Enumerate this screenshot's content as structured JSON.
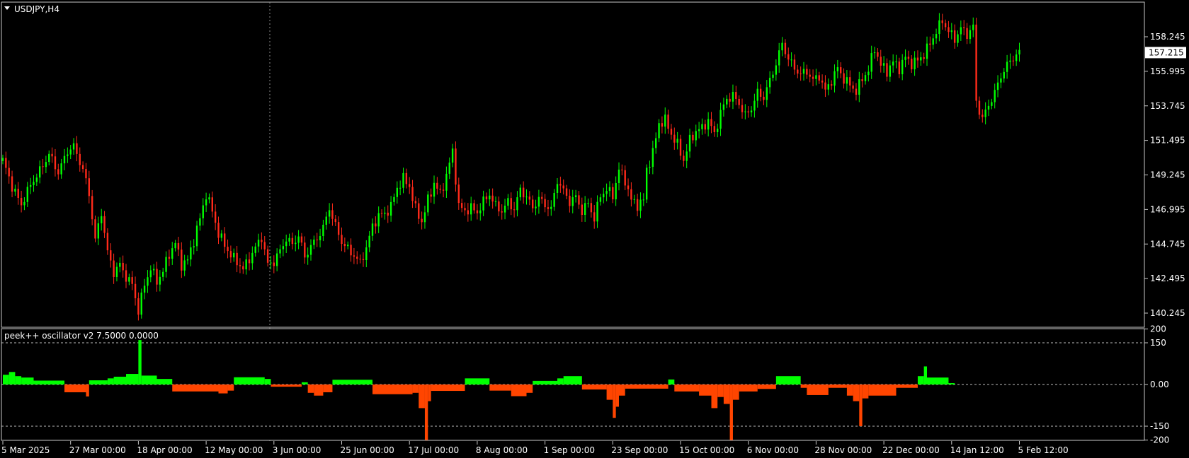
{
  "chart_data": [
    {
      "type": "candlestick",
      "title": "USDJPY,H4",
      "symbol": "USDJPY",
      "timeframe": "H4",
      "current_price_label": "157.215",
      "current_price": 157.215,
      "ylim": [
        139.2,
        160.5
      ],
      "y_ticks": [
        "158.245",
        "155.995",
        "153.745",
        "151.495",
        "149.245",
        "146.995",
        "144.745",
        "142.495",
        "140.245"
      ],
      "y_tick_values": [
        158.245,
        155.995,
        153.745,
        151.495,
        149.245,
        146.995,
        144.745,
        142.495,
        140.245
      ],
      "x_tick_labels": [
        "5 Mar 2025",
        "27 Mar 00:00",
        "18 Apr 00:00",
        "12 May 00:00",
        "3 Jun 00:00",
        "25 Jun 00:00",
        "17 Jul 00:00",
        "8 Aug 00:00",
        "1 Sep 00:00",
        "23 Sep 00:00",
        "15 Oct 00:00",
        "6 Nov 00:00",
        "28 Nov 00:00",
        "22 Dec 00:00",
        "14 Jan 12:00",
        "5 Feb 12:00"
      ],
      "x_ticks_index": [
        0,
        22,
        44,
        66,
        88,
        110,
        132,
        154,
        176,
        198,
        220,
        242,
        264,
        286,
        308,
        330
      ],
      "close_path": [
        [
          0,
          150.2
        ],
        [
          3,
          148.5
        ],
        [
          6,
          147.3
        ],
        [
          9,
          148.6
        ],
        [
          12,
          149.5
        ],
        [
          15,
          150.6
        ],
        [
          18,
          149.4
        ],
        [
          21,
          150.8
        ],
        [
          23,
          151.1
        ],
        [
          26,
          149.6
        ],
        [
          28,
          148.0
        ],
        [
          30,
          145.0
        ],
        [
          32,
          146.8
        ],
        [
          34,
          144.2
        ],
        [
          36,
          142.9
        ],
        [
          38,
          143.4
        ],
        [
          40,
          142.6
        ],
        [
          42,
          142.1
        ],
        [
          44,
          140.4
        ],
        [
          46,
          142.1
        ],
        [
          48,
          143.2
        ],
        [
          50,
          142.3
        ],
        [
          52,
          143.0
        ],
        [
          54,
          144.1
        ],
        [
          56,
          144.8
        ],
        [
          58,
          143.4
        ],
        [
          60,
          143.7
        ],
        [
          62,
          145.0
        ],
        [
          64,
          146.4
        ],
        [
          66,
          148.0
        ],
        [
          68,
          146.9
        ],
        [
          70,
          145.4
        ],
        [
          72,
          144.7
        ],
        [
          74,
          144.0
        ],
        [
          76,
          143.6
        ],
        [
          78,
          143.1
        ],
        [
          80,
          143.8
        ],
        [
          82,
          144.5
        ],
        [
          84,
          145.2
        ],
        [
          86,
          143.4
        ],
        [
          88,
          143.6
        ],
        [
          90,
          144.3
        ],
        [
          92,
          145.1
        ],
        [
          94,
          144.7
        ],
        [
          96,
          145.3
        ],
        [
          98,
          143.9
        ],
        [
          100,
          144.6
        ],
        [
          102,
          145.1
        ],
        [
          104,
          145.8
        ],
        [
          106,
          147.1
        ],
        [
          108,
          145.9
        ],
        [
          110,
          144.9
        ],
        [
          112,
          144.4
        ],
        [
          114,
          144.0
        ],
        [
          116,
          143.5
        ],
        [
          118,
          144.5
        ],
        [
          120,
          145.9
        ],
        [
          122,
          146.6
        ],
        [
          124,
          146.7
        ],
        [
          126,
          147.2
        ],
        [
          128,
          148.4
        ],
        [
          130,
          149.0
        ],
        [
          132,
          148.5
        ],
        [
          134,
          147.0
        ],
        [
          136,
          146.2
        ],
        [
          138,
          147.6
        ],
        [
          140,
          148.7
        ],
        [
          142,
          148.0
        ],
        [
          144,
          149.2
        ],
        [
          146,
          150.8
        ],
        [
          148,
          147.2
        ],
        [
          150,
          146.9
        ],
        [
          152,
          147.1
        ],
        [
          154,
          146.8
        ],
        [
          156,
          147.5
        ],
        [
          158,
          148.0
        ],
        [
          160,
          147.2
        ],
        [
          162,
          146.9
        ],
        [
          164,
          147.5
        ],
        [
          166,
          147.0
        ],
        [
          168,
          148.3
        ],
        [
          170,
          147.8
        ],
        [
          172,
          147.1
        ],
        [
          174,
          147.7
        ],
        [
          176,
          147.3
        ],
        [
          178,
          147.0
        ],
        [
          180,
          148.9
        ],
        [
          182,
          148.2
        ],
        [
          184,
          147.5
        ],
        [
          186,
          147.8
        ],
        [
          188,
          146.9
        ],
        [
          190,
          147.4
        ],
        [
          192,
          146.4
        ],
        [
          194,
          147.9
        ],
        [
          196,
          148.3
        ],
        [
          198,
          147.9
        ],
        [
          200,
          149.6
        ],
        [
          202,
          148.9
        ],
        [
          204,
          147.6
        ],
        [
          206,
          147.3
        ],
        [
          208,
          147.6
        ],
        [
          209,
          149.6
        ],
        [
          211,
          150.7
        ],
        [
          213,
          152.6
        ],
        [
          215,
          152.8
        ],
        [
          217,
          151.9
        ],
        [
          219,
          151.2
        ],
        [
          221,
          150.2
        ],
        [
          223,
          151.5
        ],
        [
          225,
          152.1
        ],
        [
          227,
          152.3
        ],
        [
          229,
          152.8
        ],
        [
          231,
          151.9
        ],
        [
          233,
          153.3
        ],
        [
          235,
          154.2
        ],
        [
          237,
          154.4
        ],
        [
          239,
          153.9
        ],
        [
          241,
          153.1
        ],
        [
          243,
          153.6
        ],
        [
          245,
          154.6
        ],
        [
          247,
          154.3
        ],
        [
          249,
          155.4
        ],
        [
          251,
          156.5
        ],
        [
          253,
          157.8
        ],
        [
          255,
          156.8
        ],
        [
          257,
          156.2
        ],
        [
          259,
          155.8
        ],
        [
          261,
          156.0
        ],
        [
          263,
          155.4
        ],
        [
          265,
          155.7
        ],
        [
          267,
          154.7
        ],
        [
          269,
          155.4
        ],
        [
          271,
          156.2
        ],
        [
          273,
          155.5
        ],
        [
          275,
          155.1
        ],
        [
          277,
          154.7
        ],
        [
          279,
          155.5
        ],
        [
          281,
          156.1
        ],
        [
          283,
          157.5
        ],
        [
          285,
          156.4
        ],
        [
          287,
          156.0
        ],
        [
          289,
          156.6
        ],
        [
          291,
          156.2
        ],
        [
          293,
          156.9
        ],
        [
          295,
          156.5
        ],
        [
          297,
          156.7
        ],
        [
          299,
          157.1
        ],
        [
          301,
          157.8
        ],
        [
          303,
          158.6
        ],
        [
          305,
          159.3
        ],
        [
          307,
          158.6
        ],
        [
          309,
          158.1
        ],
        [
          311,
          158.8
        ],
        [
          313,
          158.4
        ],
        [
          315,
          158.9
        ],
        [
          316,
          154.0
        ],
        [
          318,
          152.9
        ],
        [
          320,
          153.8
        ],
        [
          322,
          154.6
        ],
        [
          324,
          155.7
        ],
        [
          326,
          156.4
        ],
        [
          328,
          156.9
        ],
        [
          330,
          157.2
        ]
      ],
      "n_bars": 331
    },
    {
      "type": "histogram",
      "title": "peek++ oscillator v2 7.5000 0.0000",
      "indicator_name": "peek++ oscillator v2",
      "params": [
        "7.5000",
        "0.0000"
      ],
      "ylim": [
        -205,
        205
      ],
      "y_ticks": [
        "200",
        "150",
        "0.00",
        "-150",
        "-200"
      ],
      "y_tick_values": [
        200,
        150,
        0,
        -150,
        -200
      ],
      "levels": [
        150,
        0,
        -150
      ],
      "positive_color": "#00ff00",
      "negative_color": "#ff4500",
      "segments": [
        {
          "from": 0,
          "to": 2,
          "value": 35
        },
        {
          "from": 2,
          "to": 4,
          "value": 45
        },
        {
          "from": 4,
          "to": 6,
          "value": 30
        },
        {
          "from": 6,
          "to": 10,
          "value": 25
        },
        {
          "from": 10,
          "to": 20,
          "value": 14
        },
        {
          "from": 20,
          "to": 27,
          "value": -28
        },
        {
          "from": 27,
          "to": 28,
          "value": -43
        },
        {
          "from": 28,
          "to": 34,
          "value": 15
        },
        {
          "from": 34,
          "to": 36,
          "value": 22
        },
        {
          "from": 36,
          "to": 40,
          "value": 28
        },
        {
          "from": 40,
          "to": 44,
          "value": 38
        },
        {
          "from": 44,
          "to": 45,
          "value": 160
        },
        {
          "from": 45,
          "to": 50,
          "value": 32
        },
        {
          "from": 50,
          "to": 55,
          "value": 20
        },
        {
          "from": 55,
          "to": 70,
          "value": -25
        },
        {
          "from": 70,
          "to": 73,
          "value": -32
        },
        {
          "from": 73,
          "to": 75,
          "value": -22
        },
        {
          "from": 75,
          "to": 85,
          "value": 26
        },
        {
          "from": 85,
          "to": 87,
          "value": 20
        },
        {
          "from": 87,
          "to": 97,
          "value": -8
        },
        {
          "from": 97,
          "to": 99,
          "value": 8
        },
        {
          "from": 99,
          "to": 101,
          "value": -30
        },
        {
          "from": 101,
          "to": 104,
          "value": -40
        },
        {
          "from": 104,
          "to": 107,
          "value": -28
        },
        {
          "from": 107,
          "to": 120,
          "value": 17
        },
        {
          "from": 120,
          "to": 133,
          "value": -35
        },
        {
          "from": 133,
          "to": 135,
          "value": -30
        },
        {
          "from": 135,
          "to": 137,
          "value": -85
        },
        {
          "from": 137,
          "to": 138,
          "value": -200
        },
        {
          "from": 138,
          "to": 139,
          "value": -60
        },
        {
          "from": 139,
          "to": 150,
          "value": -23
        },
        {
          "from": 150,
          "to": 158,
          "value": 22
        },
        {
          "from": 158,
          "to": 165,
          "value": -22
        },
        {
          "from": 165,
          "to": 170,
          "value": -42
        },
        {
          "from": 170,
          "to": 172,
          "value": -30
        },
        {
          "from": 172,
          "to": 180,
          "value": 13
        },
        {
          "from": 180,
          "to": 182,
          "value": 22
        },
        {
          "from": 182,
          "to": 188,
          "value": 30
        },
        {
          "from": 188,
          "to": 196,
          "value": -18
        },
        {
          "from": 196,
          "to": 198,
          "value": -55
        },
        {
          "from": 198,
          "to": 199,
          "value": -120
        },
        {
          "from": 199,
          "to": 200,
          "value": -80
        },
        {
          "from": 200,
          "to": 202,
          "value": -40
        },
        {
          "from": 202,
          "to": 216,
          "value": -15
        },
        {
          "from": 216,
          "to": 218,
          "value": 18
        },
        {
          "from": 218,
          "to": 226,
          "value": -25
        },
        {
          "from": 226,
          "to": 230,
          "value": -40
        },
        {
          "from": 230,
          "to": 232,
          "value": -85
        },
        {
          "from": 232,
          "to": 234,
          "value": -45
        },
        {
          "from": 234,
          "to": 236,
          "value": -70
        },
        {
          "from": 236,
          "to": 237,
          "value": -200
        },
        {
          "from": 237,
          "to": 239,
          "value": -55
        },
        {
          "from": 239,
          "to": 245,
          "value": -25
        },
        {
          "from": 245,
          "to": 251,
          "value": -16
        },
        {
          "from": 251,
          "to": 259,
          "value": 30
        },
        {
          "from": 259,
          "to": 261,
          "value": -12
        },
        {
          "from": 261,
          "to": 268,
          "value": -38
        },
        {
          "from": 268,
          "to": 274,
          "value": -12
        },
        {
          "from": 274,
          "to": 276,
          "value": -40
        },
        {
          "from": 276,
          "to": 278,
          "value": -60
        },
        {
          "from": 278,
          "to": 279,
          "value": -150
        },
        {
          "from": 279,
          "to": 281,
          "value": -50
        },
        {
          "from": 281,
          "to": 290,
          "value": -40
        },
        {
          "from": 290,
          "to": 297,
          "value": -12
        },
        {
          "from": 297,
          "to": 299,
          "value": 30
        },
        {
          "from": 299,
          "to": 300,
          "value": 65
        },
        {
          "from": 300,
          "to": 307,
          "value": 25
        },
        {
          "from": 307,
          "to": 309,
          "value": 5
        }
      ]
    }
  ]
}
